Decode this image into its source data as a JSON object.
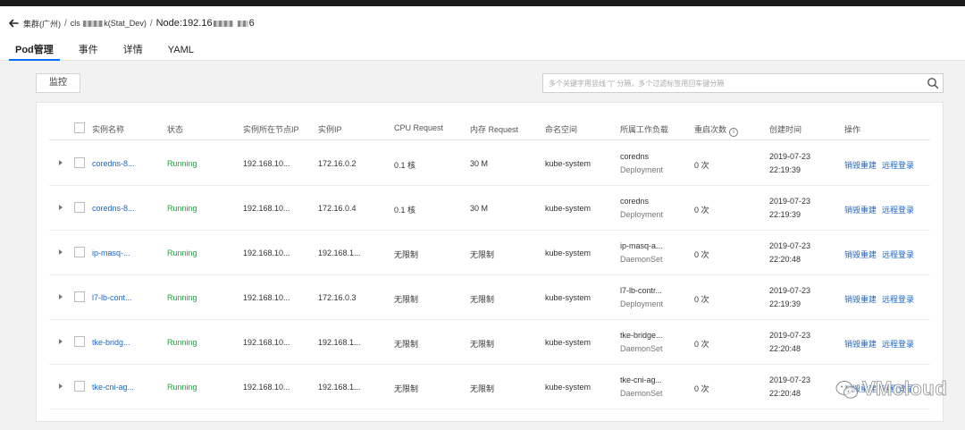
{
  "breadcrumb": {
    "cluster": "集群(广州)",
    "cls_prefix": "cls",
    "cls_suffix": "k(Stat_Dev)",
    "node_prefix": "Node:192.16",
    "node_suffix": "6"
  },
  "tabs": [
    {
      "label": "Pod管理",
      "active": true
    },
    {
      "label": "事件"
    },
    {
      "label": "详情"
    },
    {
      "label": "YAML"
    }
  ],
  "toolbar": {
    "monitor_label": "监控",
    "search_placeholder": "多个关键字用竖线 \"|\" 分隔，多个过滤标签用回车键分隔"
  },
  "table": {
    "columns": {
      "name": "实例名称",
      "status": "状态",
      "node_ip": "实例所在节点IP",
      "pod_ip": "实例IP",
      "cpu": "CPU Request",
      "mem": "内存 Request",
      "namespace": "命名空间",
      "workload": "所属工作负载",
      "restarts": "重启次数",
      "created": "创建时间",
      "actions": "操作"
    },
    "action_labels": {
      "rebuild": "销毁重建",
      "login": "远程登录"
    },
    "rows": [
      {
        "name": "coredns-8...",
        "status": "Running",
        "node_ip": "192.168.10...",
        "pod_ip": "172.16.0.2",
        "cpu": "0.1 核",
        "mem": "30 M",
        "namespace": "kube-system",
        "workload": "coredns",
        "workload_type": "Deployment",
        "restarts": "0 次",
        "created_date": "2019-07-23",
        "created_time": "22:19:39"
      },
      {
        "name": "coredns-8...",
        "status": "Running",
        "node_ip": "192.168.10...",
        "pod_ip": "172.16.0.4",
        "cpu": "0.1 核",
        "mem": "30 M",
        "namespace": "kube-system",
        "workload": "coredns",
        "workload_type": "Deployment",
        "restarts": "0 次",
        "created_date": "2019-07-23",
        "created_time": "22:19:39"
      },
      {
        "name": "ip-masq-...",
        "status": "Running",
        "node_ip": "192.168.10...",
        "pod_ip": "192.168.1...",
        "cpu": "无限制",
        "mem": "无限制",
        "namespace": "kube-system",
        "workload": "ip-masq-a...",
        "workload_type": "DaemonSet",
        "restarts": "0 次",
        "created_date": "2019-07-23",
        "created_time": "22:20:48"
      },
      {
        "name": "l7-lb-cont...",
        "status": "Running",
        "node_ip": "192.168.10...",
        "pod_ip": "172.16.0.3",
        "cpu": "无限制",
        "mem": "无限制",
        "namespace": "kube-system",
        "workload": "l7-lb-contr...",
        "workload_type": "Deployment",
        "restarts": "0 次",
        "created_date": "2019-07-23",
        "created_time": "22:19:39"
      },
      {
        "name": "tke-bridg...",
        "status": "Running",
        "node_ip": "192.168.10...",
        "pod_ip": "192.168.1...",
        "cpu": "无限制",
        "mem": "无限制",
        "namespace": "kube-system",
        "workload": "tke-bridge...",
        "workload_type": "DaemonSet",
        "restarts": "0 次",
        "created_date": "2019-07-23",
        "created_time": "22:20:48"
      },
      {
        "name": "tke-cni-ag...",
        "status": "Running",
        "node_ip": "192.168.10...",
        "pod_ip": "192.168.1...",
        "cpu": "无限制",
        "mem": "无限制",
        "namespace": "kube-system",
        "workload": "tke-cni-ag...",
        "workload_type": "DaemonSet",
        "restarts": "0 次",
        "created_date": "2019-07-23",
        "created_time": "22:20:48"
      }
    ]
  },
  "watermark": {
    "text": "VMcloud"
  },
  "colors": {
    "primary": "#006eff",
    "link": "#1f66c3",
    "running": "#26a340"
  }
}
